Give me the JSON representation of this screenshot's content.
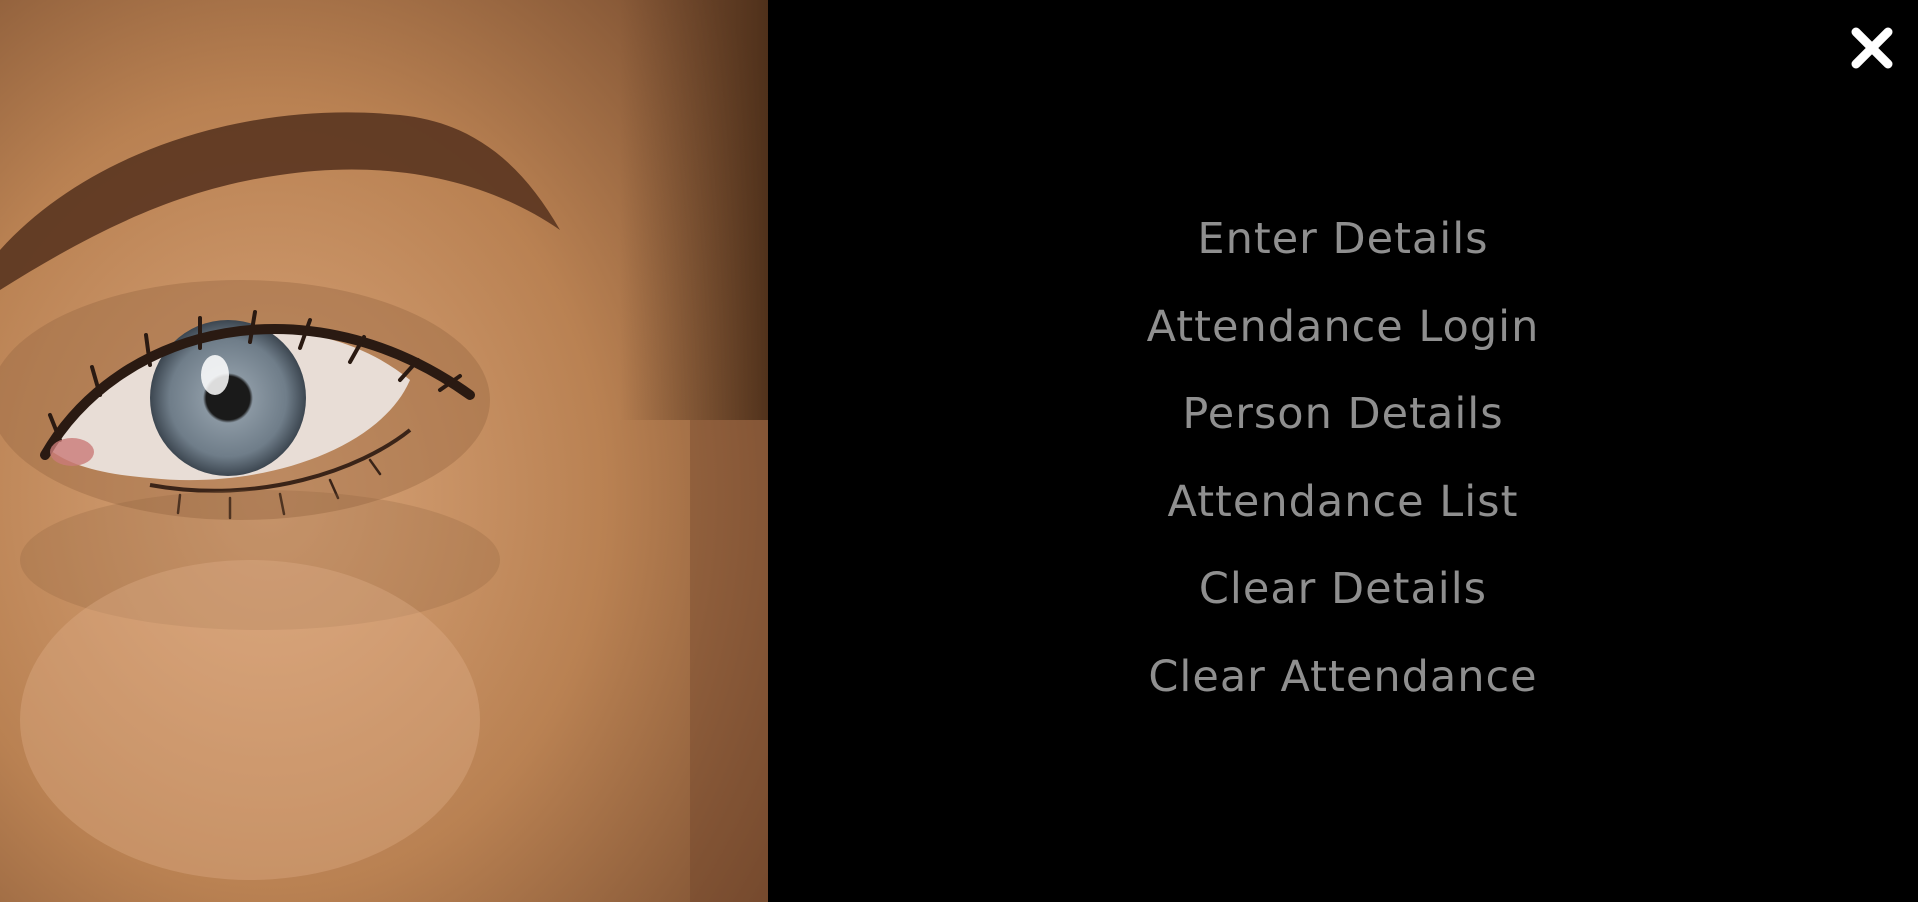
{
  "hero": {
    "image": "eye-closeup-photo",
    "skin_color": "#c08a5c",
    "iris_color": "#6d7a86"
  },
  "close_button": {
    "icon": "close-icon",
    "color": "#ffffff"
  },
  "menu": {
    "text_color": "#8f8f8f",
    "items": [
      {
        "label": "Enter Details"
      },
      {
        "label": "Attendance Login"
      },
      {
        "label": "Person Details"
      },
      {
        "label": "Attendance List"
      },
      {
        "label": "Clear Details"
      },
      {
        "label": "Clear Attendance"
      }
    ]
  }
}
